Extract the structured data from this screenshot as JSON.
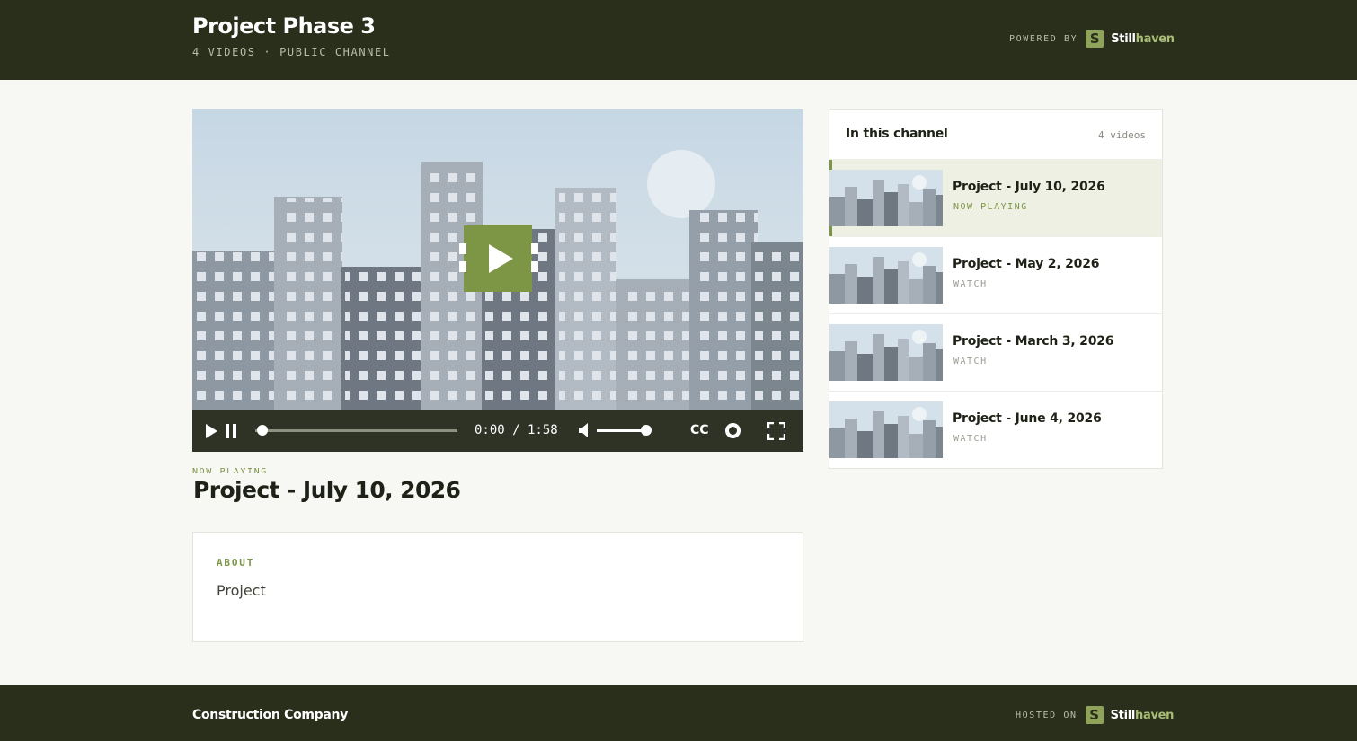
{
  "header": {
    "title": "Project Phase 3",
    "subtitle": "4 VIDEOS · PUBLIC CHANNEL",
    "powered_by": "POWERED BY",
    "logo_letter": "S",
    "brand_a": "Still",
    "brand_b": "haven"
  },
  "player": {
    "time": "0:00 / 1:58",
    "cc_label": "CC",
    "progress": 0.0,
    "volume": 1.0
  },
  "now_playing": {
    "label": "NOW PLAYING",
    "title": "Project - July 10, 2026"
  },
  "about": {
    "heading": "ABOUT",
    "text": "Project"
  },
  "sidebar": {
    "heading": "In this channel",
    "count": "4 videos",
    "items": [
      {
        "title": "Project - July 10, 2026",
        "status": "NOW PLAYING"
      },
      {
        "title": "Project - May 2, 2026",
        "status": "WATCH"
      },
      {
        "title": "Project - March 3, 2026",
        "status": "WATCH"
      },
      {
        "title": "Project - June 4, 2026",
        "status": "WATCH"
      }
    ]
  },
  "footer": {
    "company": "Construction Company",
    "hosted_on": "HOSTED ON",
    "logo_letter": "S",
    "brand_a": "Still",
    "brand_b": "haven"
  },
  "colors": {
    "header_bg": "#2a2f1c",
    "accent": "#7c9646",
    "page_bg": "#f7f7f3"
  }
}
